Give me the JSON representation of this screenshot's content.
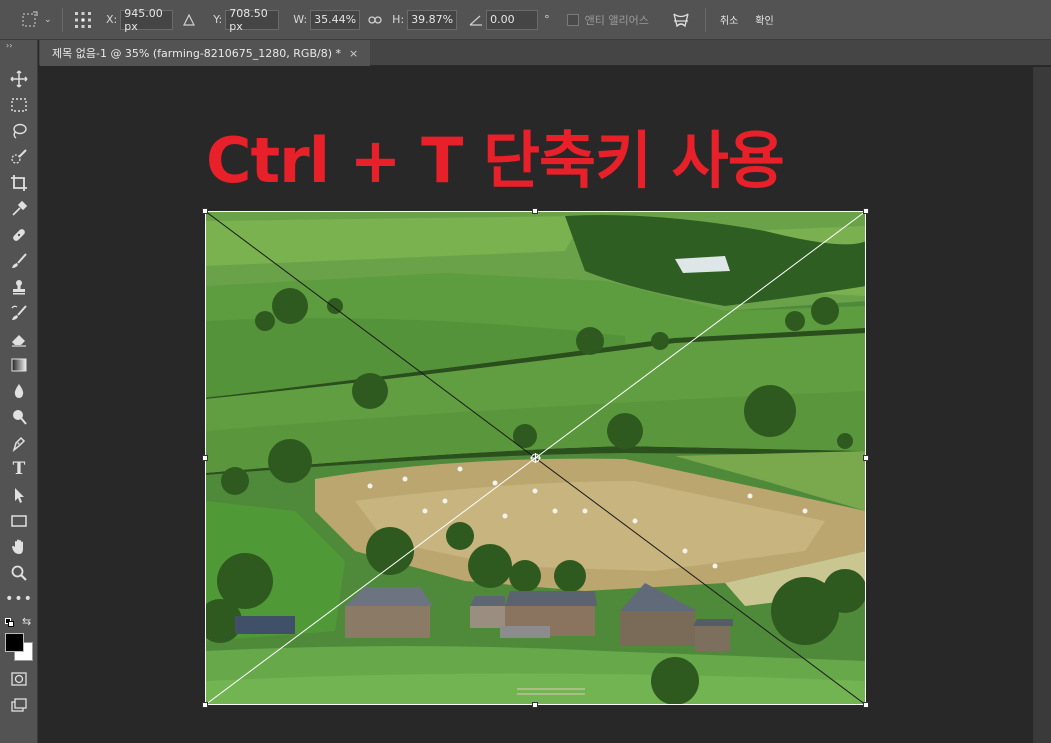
{
  "options_bar": {
    "x_label": "X:",
    "x_value": "945.00 px",
    "y_label": "Y:",
    "y_value": "708.50 px",
    "w_label": "W:",
    "w_value": "35.44%",
    "h_label": "H:",
    "h_value": "39.87%",
    "angle_value": "0.00",
    "angle_unit": "°",
    "anti_alias_label": "앤티 앨리어스",
    "cancel_label": "취소",
    "confirm_label": "확인"
  },
  "document_tab": {
    "title": "제목 없음-1 @ 35% (farming-8210675_1280, RGB/8) *",
    "close": "×"
  },
  "overlay": {
    "caption": "Ctrl + T 단축키 사용"
  },
  "tools": [
    "move-tool",
    "marquee-tool",
    "lasso-tool",
    "quick-selection-tool",
    "crop-tool",
    "eyedropper-tool",
    "healing-brush-tool",
    "brush-tool",
    "clone-stamp-tool",
    "history-brush-tool",
    "eraser-tool",
    "gradient-tool",
    "blur-tool",
    "dodge-tool",
    "pen-tool",
    "type-tool",
    "path-selection-tool",
    "rectangle-tool",
    "hand-tool",
    "zoom-tool",
    "more-tools"
  ],
  "colors": {
    "foreground": "#000000",
    "background": "#ffffff",
    "caption": "#e8202a"
  }
}
